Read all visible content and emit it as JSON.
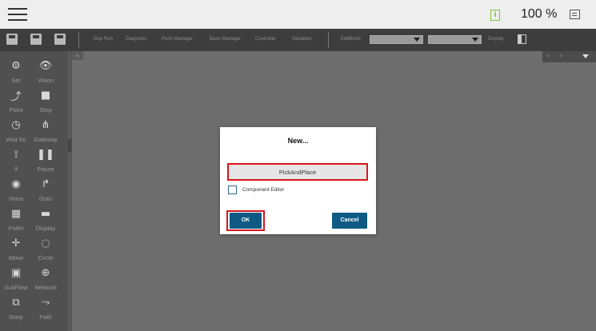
{
  "topbar": {
    "menu_icon": "hamburger-menu-icon",
    "info_icon": "info-icon",
    "info_glyph": "i",
    "zoom_level": "100 %",
    "screen_icon": "screen-icon"
  },
  "toolbar": {
    "icons": [
      "file-icon",
      "save-icon",
      "save-as-icon"
    ],
    "items": [
      "Step Run",
      "Diagnosis",
      "Point Manager",
      "Base Manager",
      "Controller",
      "Variables"
    ],
    "editblock_label": "EditBlock",
    "display_label": "Display",
    "layout_icon": "layout-toggle-icon"
  },
  "sidebar": {
    "items": [
      {
        "label": "Set",
        "icon": "set-icon",
        "glyph": "⚙"
      },
      {
        "label": "Vision",
        "icon": "vision-icon",
        "glyph": "👁"
      },
      {
        "label": "Point",
        "icon": "point-icon",
        "glyph": "⤴"
      },
      {
        "label": "Stop",
        "icon": "stop-icon",
        "glyph": "■"
      },
      {
        "label": "Wait for",
        "icon": "wait-for-icon",
        "glyph": "◷"
      },
      {
        "label": "Gateway",
        "icon": "gateway-icon",
        "glyph": "⋔"
      },
      {
        "label": "If",
        "icon": "if-icon",
        "glyph": "⟟"
      },
      {
        "label": "Pause",
        "icon": "pause-icon",
        "glyph": "❚❚"
      },
      {
        "label": "Voice",
        "icon": "voice-icon",
        "glyph": "◉"
      },
      {
        "label": "Goto",
        "icon": "goto-icon",
        "glyph": "↱"
      },
      {
        "label": "Pallet",
        "icon": "pallet-icon",
        "glyph": "▦"
      },
      {
        "label": "Display",
        "icon": "display-icon",
        "glyph": "▬"
      },
      {
        "label": "Move",
        "icon": "move-icon",
        "glyph": "✛"
      },
      {
        "label": "Circle",
        "icon": "circle-icon",
        "glyph": "◌"
      },
      {
        "label": "SubFlow",
        "icon": "subflow-icon",
        "glyph": "▣"
      },
      {
        "label": "Network",
        "icon": "network-icon",
        "glyph": "⊕"
      },
      {
        "label": "Warp",
        "icon": "warp-icon",
        "glyph": "⧉"
      },
      {
        "label": "Path",
        "icon": "path-icon",
        "glyph": "⤳"
      }
    ]
  },
  "canvas": {
    "collapse_glyph": "«",
    "nav_prev": "‹",
    "nav_next": "›"
  },
  "dialog": {
    "title": "New...",
    "name_value": "PickAndPlace",
    "checkbox_label": "Component Editor",
    "checkbox_checked": false,
    "ok_label": "OK",
    "cancel_label": "Cancel",
    "accent_color": "#0e5a84",
    "highlight_color": "#d9151c"
  }
}
